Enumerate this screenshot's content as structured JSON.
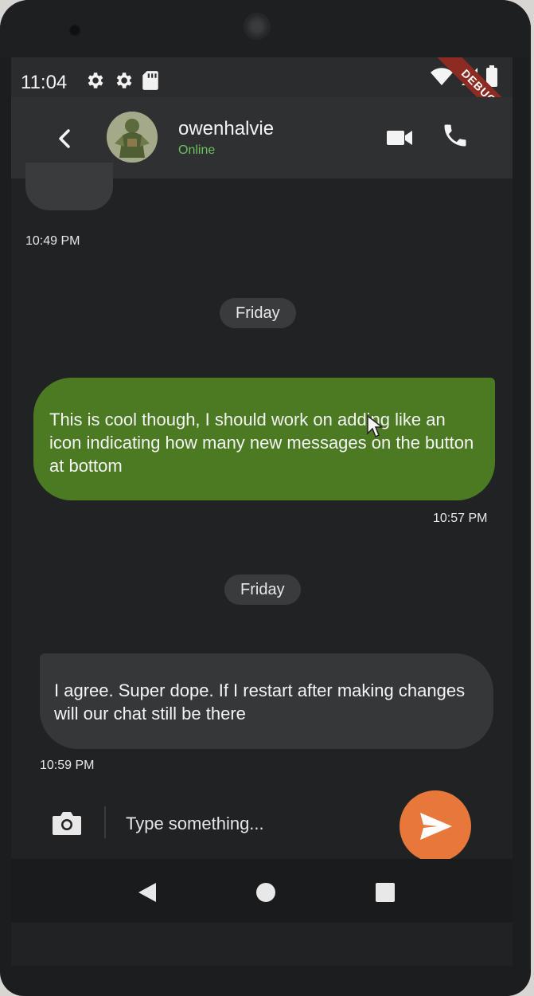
{
  "status_bar": {
    "time": "11:04",
    "icons": [
      "gear-icon",
      "gear-icon",
      "sd-card-icon"
    ],
    "right_icons": [
      "wifi-icon",
      "signal-icon",
      "battery-icon"
    ]
  },
  "debug_banner": "DEBUG",
  "app_bar": {
    "contact_name": "owenhalvie",
    "contact_status": "Online",
    "actions": [
      "video-call-icon",
      "phone-call-icon"
    ]
  },
  "messages": [
    {
      "type": "received",
      "text": "",
      "time": "10:49 PM"
    },
    {
      "type": "date",
      "label": "Friday"
    },
    {
      "type": "sent",
      "text": "This is cool though, I should work on adding like an icon indicating how many new messages on the button at bottom",
      "time": "10:57 PM"
    },
    {
      "type": "date",
      "label": "Friday"
    },
    {
      "type": "received",
      "text": "I agree. Super dope. If I restart after making changes will our chat still be there",
      "time": "10:59 PM"
    }
  ],
  "composer": {
    "placeholder": "Type something..."
  },
  "colors": {
    "sent_bubble": "#4b7a22",
    "received_bubble": "#363739",
    "online": "#6ac25e",
    "send_button": "#e8783a",
    "background": "#212224"
  }
}
